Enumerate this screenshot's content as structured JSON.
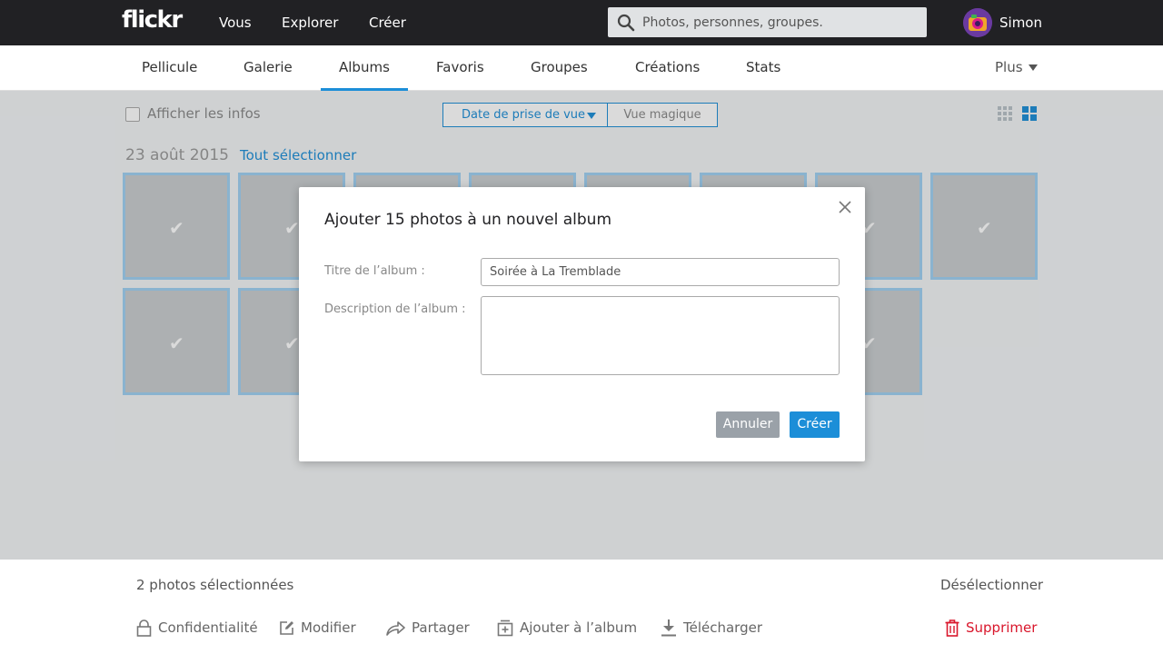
{
  "topbar": {
    "logo": "flickr",
    "nav": [
      "Vous",
      "Explorer",
      "Créer"
    ],
    "search_placeholder": "Photos, personnes, groupes.",
    "user_name": "Simon"
  },
  "subnav": {
    "tabs": [
      "Pellicule",
      "Galerie",
      "Albums",
      "Favoris",
      "Groupes",
      "Créations",
      "Stats"
    ],
    "active_tab": "Albums",
    "more_label": "Plus"
  },
  "toolbar": {
    "show_info_label": "Afficher les infos",
    "sort_label": "Date de prise de vue",
    "magic_view_label": "Vue magique"
  },
  "photos": {
    "date_heading": "23 août 2015",
    "select_all_label": "Tout sélectionner"
  },
  "dialog": {
    "title": "Ajouter 15 photos à un nouvel album",
    "title_field_label": "Titre de l’album :",
    "title_field_value": "Soirée à La Tremblade",
    "description_field_label": "Description de l’album :",
    "description_field_value": "",
    "cancel_label": "Annuler",
    "create_label": "Créer"
  },
  "bottom": {
    "selection_count": "2 photos sélectionnées",
    "deselect_label": "Désélectionner",
    "actions": {
      "privacy": "Confidentialité",
      "edit": "Modifier",
      "share": "Partager",
      "add_to_album": "Ajouter à l’album",
      "download": "Télécharger",
      "delete": "Supprimer"
    }
  },
  "colors": {
    "accent": "#1c8ed8",
    "topbar": "#212124",
    "danger": "#d9172c"
  }
}
